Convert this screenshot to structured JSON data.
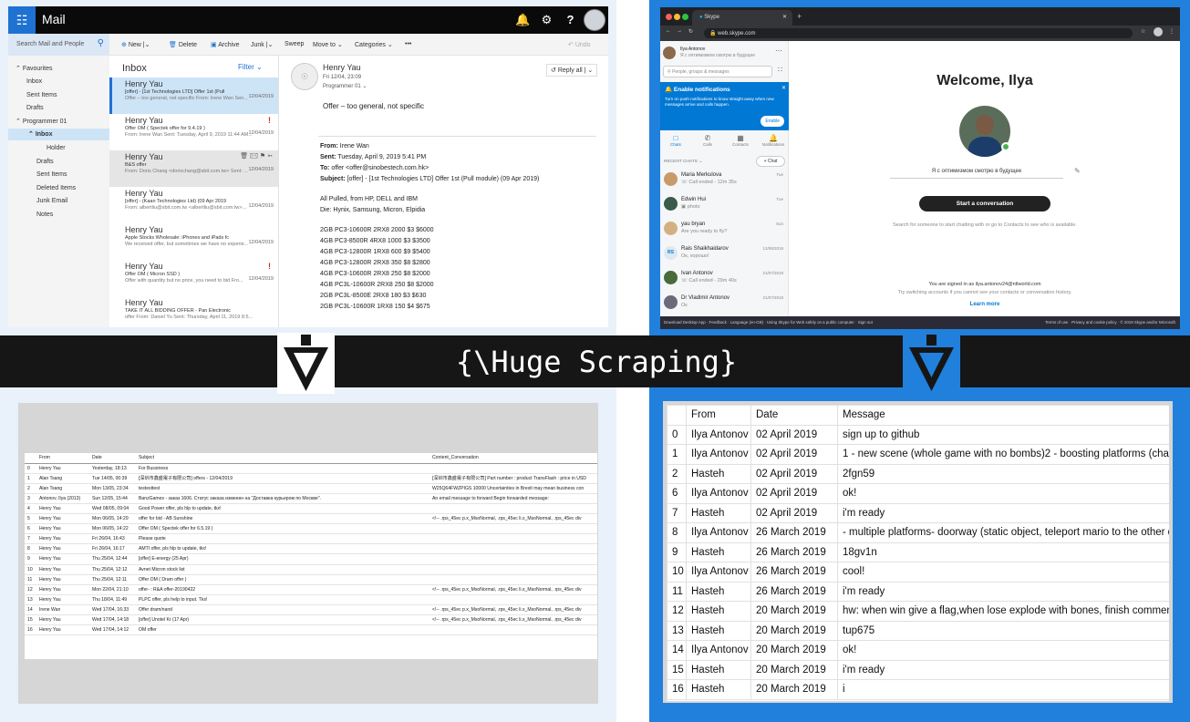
{
  "banner": {
    "text": "{\\Huge Scraping}"
  },
  "colors": {
    "outlook_blue": "#1e72d2",
    "skype_blue": "#0078d4",
    "right_bg": "#2080dc",
    "left_bg": "#e9f1fa",
    "band": "#161616"
  },
  "outlook": {
    "app_name": "Mail",
    "top_icons": [
      "bell-icon",
      "gear-icon",
      "help-icon"
    ],
    "search_placeholder": "Search Mail and People",
    "commands": {
      "new": "New",
      "delete": "Delete",
      "archive": "Archive",
      "junk": "Junk",
      "sweep": "Sweep",
      "move_to": "Move to",
      "categories": "Categories",
      "more": "•••",
      "undo": "Undo"
    },
    "nav": {
      "favourites": "Favourites",
      "inbox": "Inbox",
      "sent": "Sent Items",
      "drafts": "Drafts",
      "folder": "Programmer 01",
      "folder_inbox": "Inbox",
      "holder": "Holder",
      "drafts2": "Drafts",
      "sent2": "Sent Items",
      "deleted": "Deleted Items",
      "junk": "Junk Email",
      "notes": "Notes"
    },
    "list": {
      "title": "Inbox",
      "filter": "Filter",
      "items": [
        {
          "sender": "Henry Yau",
          "subject": "[offer] - [1st Technologies LTD] Offer 1st (Pull",
          "date": "12/04/2019",
          "preview": "Offer – too general, not specific From: Irene Wan Sen..."
        },
        {
          "sender": "Henry Yau",
          "subject": "Offer OM ( Spectek offer for 9.4.19 )",
          "date": "12/04/2019",
          "preview": "From: Irene Wan Sent: Tuesday, April 9, 2019 11:44 AM..."
        },
        {
          "sender": "Henry Yau",
          "subject": "B&S offer",
          "date": "12/04/2019",
          "preview": "From: Doris Chang <dorischang@sbit.com.tw> Sent: ..."
        },
        {
          "sender": "Henry Yau",
          "subject": "[offer] - (Kaan Technologies Ltd) (09 Apr 2019",
          "date": "12/04/2019",
          "preview": "From: albertliu@sbit.com.tw <albertliu@sbit.com.tw>..."
        },
        {
          "sender": "Henry Yau",
          "subject": "Apple Stocks Wholesale: iPhones and iPads fc",
          "date": "12/04/2019",
          "preview": "We received offer, but sometimes we have no experie..."
        },
        {
          "sender": "Henry Yau",
          "subject": "Offer OM ( Micron SSD )",
          "date": "12/04/2019",
          "preview": "Offer with quantity but no price, you need to bid Fro..."
        },
        {
          "sender": "Henry Yau",
          "subject": "TAKE IT ALL BIDDING OFFER - Pan Electronic",
          "date": "12/04/2019",
          "preview": "offer From: Daniel Yu Sent: Thursday, April 11, 2019 8:5..."
        }
      ]
    },
    "reading": {
      "sender": "Henry Yau",
      "date": "Fri 12/04, 23:09",
      "to": "Programmer 01",
      "reply_all": "Reply all",
      "body_intro": "Offer – too general, not specific",
      "from_label": "From:",
      "from_val": "Irene Wan",
      "sent_label": "Sent:",
      "sent_val": "Tuesday, April 9, 2019 5:41 PM",
      "to_label": "To:",
      "to_val": "offer <offer@sinobestech.com.hk>",
      "subject_label": "Subject:",
      "subject_val": "[offer] - [1st Technologies LTD] Offer 1st (Pull module) (09 Apr 2019)",
      "line1": "All Pulled, from HP, DELL and IBM",
      "line2": "Die: Hynix, Samsung, Micron, Elpidia",
      "specs": [
        "2GB PC3-10600R 2RX8 2000 $3 $6000",
        "4GB PC3-8500R 4RX8 1000 $3 $3500",
        "4GB PC3-12800R 1RX8 600 $9 $5400",
        "4GB PC3-12800R 2RX8 350 $8 $2800",
        "4GB PC3-10600R 2RX8 250 $8 $2000",
        "4GB PC3L-10600R 2RX8 250 $8 $2000",
        "2GB PC3L-8500E 2RX8 180 $3 $630",
        "2GB PC3L-10600R 1RX8 150 $4 $675"
      ]
    }
  },
  "skype": {
    "tab_title": "Skype",
    "url": "web.skype.com",
    "me": {
      "name": "Ilya Antonov",
      "mood": "Я с оптимизмом смотрю в будущее"
    },
    "search_placeholder": "People, groups & messages",
    "notification": {
      "title": "Enable notifications",
      "body": "Turn on push notifications to know straight away when new messages arrive and calls happen.",
      "button": "Enable"
    },
    "nav": [
      "Chats",
      "Calls",
      "Contacts",
      "Notifications"
    ],
    "recent_label": "RECENT CHATS",
    "chat_button": "+ Chat",
    "chats": [
      {
        "name": "Maria Merkulova",
        "preview": "Call ended - 12m 35s",
        "date": "Tue"
      },
      {
        "name": "Edwin Hui",
        "preview": "photo",
        "date": "Tue"
      },
      {
        "name": "yau bryan",
        "preview": "Are you ready to fly?",
        "date": "Sun"
      },
      {
        "name": "Rais Shaikhaidarov",
        "preview": "Ок, хорошо!",
        "date": "12/08/2019",
        "initials": "RS"
      },
      {
        "name": "Ivan Antonov",
        "preview": "Call ended - 29m 40s",
        "date": "21/07/2019"
      },
      {
        "name": "Dr Vladimir Antonov",
        "preview": "Ок",
        "date": "21/07/2019"
      }
    ],
    "welcome": "Welcome, Ilya",
    "mood": "Я с оптимизмом смотрю в будущее",
    "start": "Start a conversation",
    "hint": "Search for someone to start chatting with or go to Contacts to see who is available.",
    "signed_in": "You are signed in as ilya.antonov24@ntlworld.com",
    "try_text": "Try switching accounts if you cannot see your contacts or conversation history.",
    "learn_more": "Learn more",
    "footer_left": "Download Desktop App  ·  Feedback  ·  Language (en-GB)  ·  Using Skype for Web safely on a public computer  ·  Sign out",
    "footer_right": "Terms of use  ·  Privacy and cookie policy  ·  © 2019 Skype and/or Microsoft."
  },
  "mail_table": {
    "columns": [
      "",
      "From",
      "Date",
      "Subject",
      "Content_Conversation"
    ],
    "rows": [
      [
        "0",
        "Henry Yau",
        "Yesterday, 18:13",
        "For Bussiness",
        ""
      ],
      [
        "1",
        "Alan Tsang",
        "Tue 14/05, 00:39",
        "[深圳市鑫盛電子有限公司] offers - 12/04/2019",
        "[深圳市鑫盛電子有限公司] Part number : product TransFlash : price in USD"
      ],
      [
        "2",
        "Alan Tsang",
        "Mon 13/05, 23:34",
        "testesttest",
        "W25Q64FWZPIGS 10000  Uncertainties in Brexit may mean business con"
      ],
      [
        "3",
        "Antonov, Ilya (2013)",
        "Sun 12/05, 15:44",
        "BanzGames - заказ 1606. Статус заказа изменен на \"Доставка курьером по Москве\".",
        "An email message to forward Begin forwarded message:"
      ],
      [
        "4",
        "Henry Yau",
        "Wed 08/05, 09:04",
        "Good Power offer, pls hlp to update, tkx!",
        ""
      ],
      [
        "5",
        "Henry Yau",
        "Mon 06/05, 14:29",
        "offer for bid - AB Sunshine",
        "<!-- .rps_45ec p.x_MsoNormal, .rps_45ec li.x_MsoNormal, .rps_45ec div"
      ],
      [
        "6",
        "Henry Yau",
        "Mon 06/05, 14:22",
        "Offer OM (   Spectek offer for 6.5.19 )",
        ""
      ],
      [
        "7",
        "Henry Yau",
        "Fri 26/04, 16:43",
        "Please quote",
        ""
      ],
      [
        "8",
        "Henry Yau",
        "Fri 26/04, 16:17",
        "AMTI offer, pls hlp to update, tkx!",
        ""
      ],
      [
        "9",
        "Henry Yau",
        "Thu 25/04, 12:44",
        "[offer] E-energy (25 Apr)",
        ""
      ],
      [
        "10",
        "Henry Yau",
        "Thu 25/04, 12:12",
        "Avnet Micron stock list",
        ""
      ],
      [
        "11",
        "Henry Yau",
        "Thu 25/04, 12:11",
        "Offer OM (  Dram offer  )",
        ""
      ],
      [
        "12",
        "Henry Yau",
        "Mon 22/04, 21:10",
        "offer- : R&A offer-20190422",
        "<!-- .rps_45ec p.x_MsoNormal, .rps_45ec li.x_MsoNormal, .rps_45ec div"
      ],
      [
        "13",
        "Henry Yau",
        "Thu 18/04, 11:49",
        "PLPC offer, pls help to input. Tks!",
        ""
      ],
      [
        "14",
        "Irene Wan",
        "Wed 17/04, 16:33",
        "Offer dram/nand",
        "<!-- .rps_45ec p.x_MsoNormal, .rps_45ec li.x_MsoNormal, .rps_45ec div"
      ],
      [
        "15",
        "Henry Yau",
        "Wed 17/04, 14:18",
        "[offer] Unotel Kr (17 Apr)",
        "<!-- .rps_45ec p.x_MsoNormal, .rps_45ec li.x_MsoNormal, .rps_45ec div"
      ],
      [
        "16",
        "Henry Yau",
        "Wed 17/04, 14:12",
        "OM offer",
        ""
      ]
    ]
  },
  "skype_table": {
    "columns": [
      "",
      "From",
      "Date",
      "Message"
    ],
    "rows": [
      [
        "0",
        "Ilya Antonov",
        "02 April 2019",
        "sign up to github"
      ],
      [
        "1",
        "Ilya Antonov",
        "02 April 2019",
        "1 - new scene (whole game with no bombs)2 - boosting platforms (change"
      ],
      [
        "2",
        "Hasteh",
        "02 April 2019",
        "2fgn59"
      ],
      [
        "6",
        "Ilya Antonov",
        "02 April 2019",
        "ok!"
      ],
      [
        "7",
        "Hasteh",
        "02 April 2019",
        "i'm ready"
      ],
      [
        "8",
        "Ilya Antonov",
        "26 March 2019",
        "- multiple platforms- doorway (static object, teleport mario to the other doo"
      ],
      [
        "9",
        "Hasteh",
        "26 March 2019",
        "18gv1n"
      ],
      [
        "10",
        "Ilya Antonov",
        "26 March 2019",
        "cool!"
      ],
      [
        "11",
        "Hasteh",
        "26 March 2019",
        "i'm ready"
      ],
      [
        "12",
        "Hasteh",
        "20 March 2019",
        "hw: when win give a flag,when lose explode with bones, finish commenting"
      ],
      [
        "13",
        "Hasteh",
        "20 March 2019",
        "tup675"
      ],
      [
        "14",
        "Ilya Antonov",
        "20 March 2019",
        "ok!"
      ],
      [
        "15",
        "Hasteh",
        "20 March 2019",
        "i'm ready"
      ],
      [
        "16",
        "Hasteh",
        "20 March 2019",
        "i"
      ]
    ]
  }
}
